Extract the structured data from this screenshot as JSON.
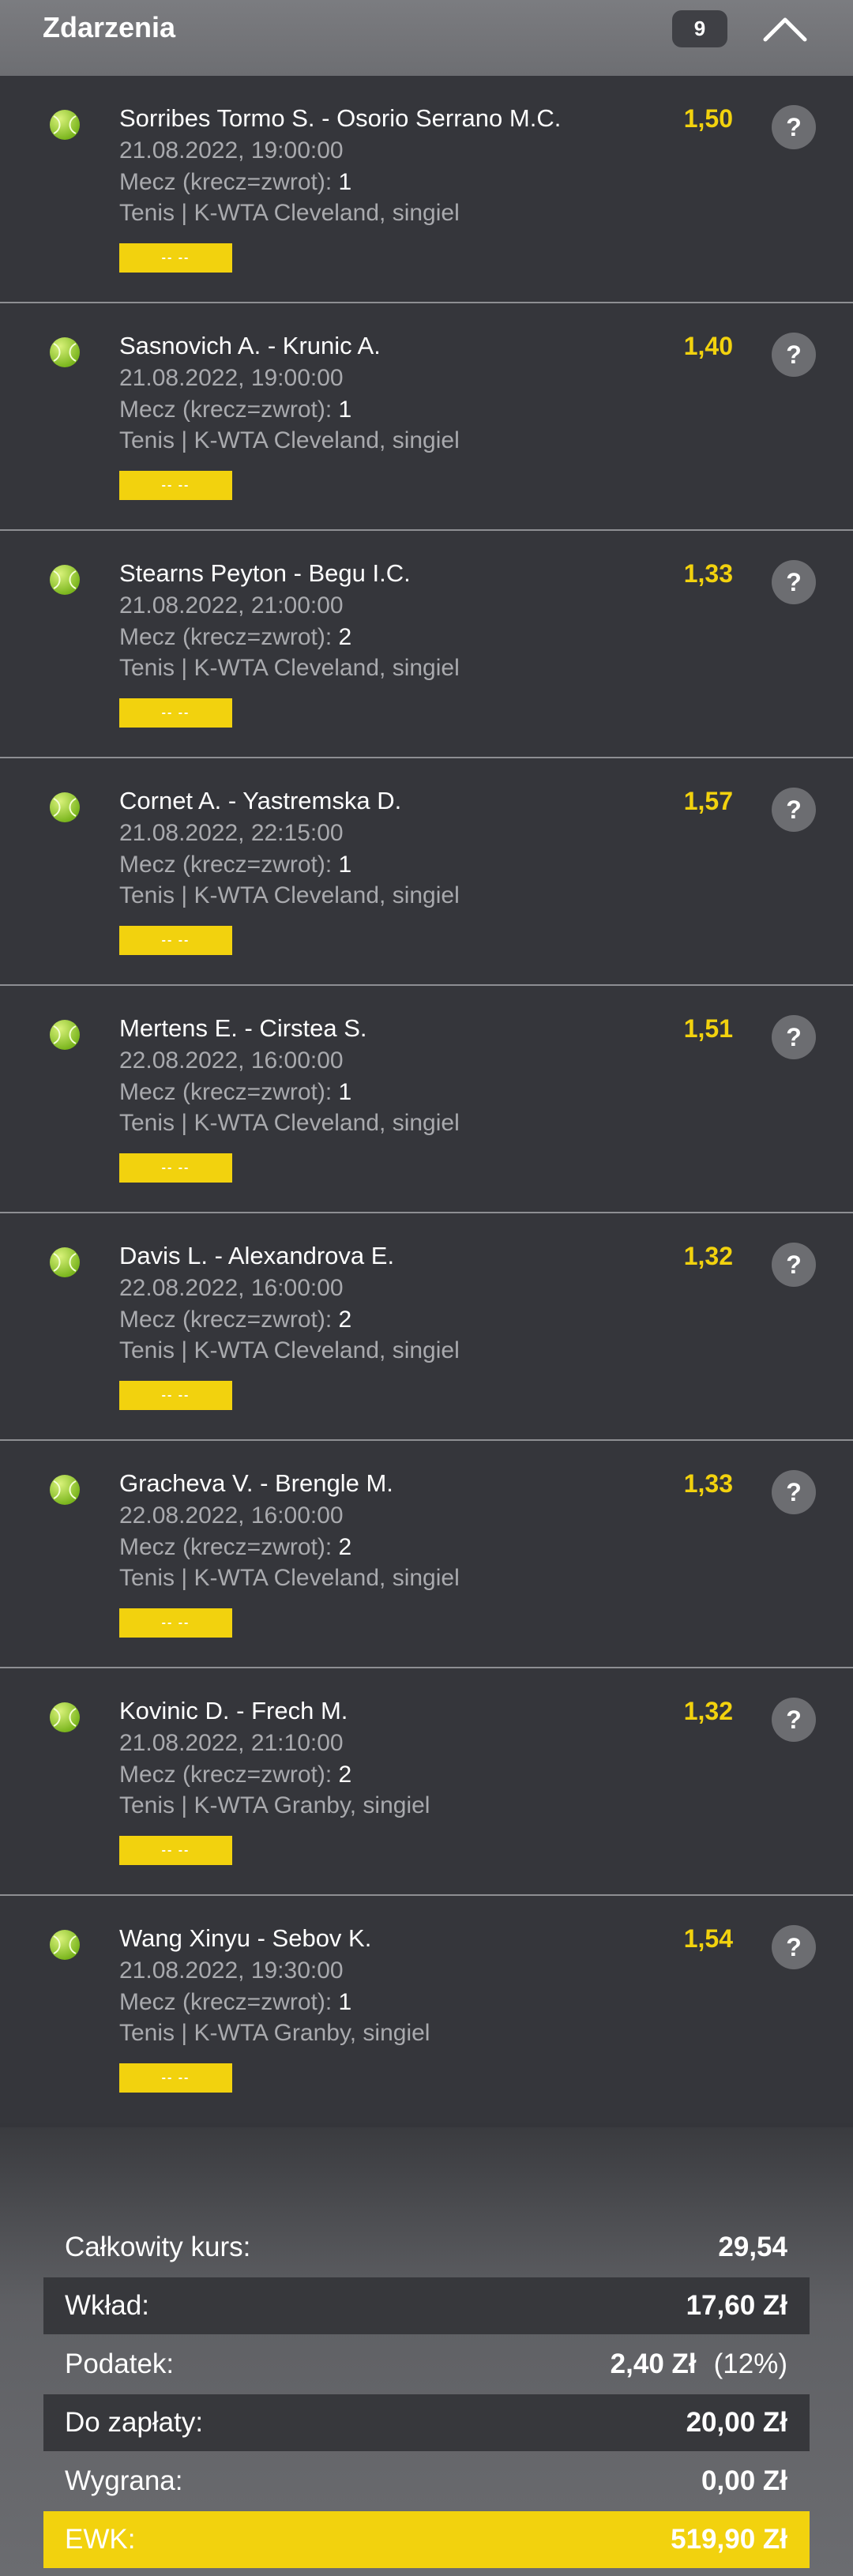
{
  "header": {
    "title": "Zdarzenia",
    "count": "9"
  },
  "events": [
    {
      "title": "Sorribes Tormo S. - Osorio Serrano M.C.",
      "date": "21.08.2022, 19:00:00",
      "market_label": "Mecz (krecz=zwrot):",
      "pick": "1",
      "league": "Tenis | K-WTA Cleveland, singiel",
      "odds": "1,50",
      "status": "-- --"
    },
    {
      "title": "Sasnovich A. - Krunic A.",
      "date": "21.08.2022, 19:00:00",
      "market_label": "Mecz (krecz=zwrot):",
      "pick": "1",
      "league": "Tenis | K-WTA Cleveland, singiel",
      "odds": "1,40",
      "status": "-- --"
    },
    {
      "title": "Stearns Peyton - Begu I.C.",
      "date": "21.08.2022, 21:00:00",
      "market_label": "Mecz (krecz=zwrot):",
      "pick": "2",
      "league": "Tenis | K-WTA Cleveland, singiel",
      "odds": "1,33",
      "status": "-- --"
    },
    {
      "title": "Cornet A. - Yastremska D.",
      "date": "21.08.2022, 22:15:00",
      "market_label": "Mecz (krecz=zwrot):",
      "pick": "1",
      "league": "Tenis | K-WTA Cleveland, singiel",
      "odds": "1,57",
      "status": "-- --"
    },
    {
      "title": "Mertens E. - Cirstea S.",
      "date": "22.08.2022, 16:00:00",
      "market_label": "Mecz (krecz=zwrot):",
      "pick": "1",
      "league": "Tenis | K-WTA Cleveland, singiel",
      "odds": "1,51",
      "status": "-- --"
    },
    {
      "title": "Davis L. - Alexandrova E.",
      "date": "22.08.2022, 16:00:00",
      "market_label": "Mecz (krecz=zwrot):",
      "pick": "2",
      "league": "Tenis | K-WTA Cleveland, singiel",
      "odds": "1,32",
      "status": "-- --"
    },
    {
      "title": "Gracheva V. - Brengle M.",
      "date": "22.08.2022, 16:00:00",
      "market_label": "Mecz (krecz=zwrot):",
      "pick": "2",
      "league": "Tenis | K-WTA Cleveland, singiel",
      "odds": "1,33",
      "status": "-- --"
    },
    {
      "title": "Kovinic D. - Frech M.",
      "date": "21.08.2022, 21:10:00",
      "market_label": "Mecz (krecz=zwrot):",
      "pick": "2",
      "league": "Tenis | K-WTA Granby, singiel",
      "odds": "1,32",
      "status": "-- --"
    },
    {
      "title": "Wang Xinyu - Sebov K.",
      "date": "21.08.2022, 19:30:00",
      "market_label": "Mecz (krecz=zwrot):",
      "pick": "1",
      "league": "Tenis | K-WTA Granby, singiel",
      "odds": "1,54",
      "status": "-- --"
    }
  ],
  "event_icon": "tennis-ball-icon",
  "help_icon": "question-icon",
  "help_glyph": "?",
  "summary": {
    "total_odds_label": "Całkowity kurs:",
    "total_odds_value": "29,54",
    "stake_label": "Wkład:",
    "stake_value": "17,60 Zł",
    "tax_label": "Podatek:",
    "tax_value": "2,40 Zł",
    "tax_rate": "(12%)",
    "to_pay_label": "Do zapłaty:",
    "to_pay_value": "20,00 Zł",
    "win_label": "Wygrana:",
    "win_value": "0,00 Zł",
    "ewk_label": "EWK:",
    "ewk_value": "519,90 Zł"
  },
  "colors": {
    "accent": "#f2d20e",
    "background": "#35363b",
    "header": "#747579",
    "muted_text": "#a9aaae"
  }
}
